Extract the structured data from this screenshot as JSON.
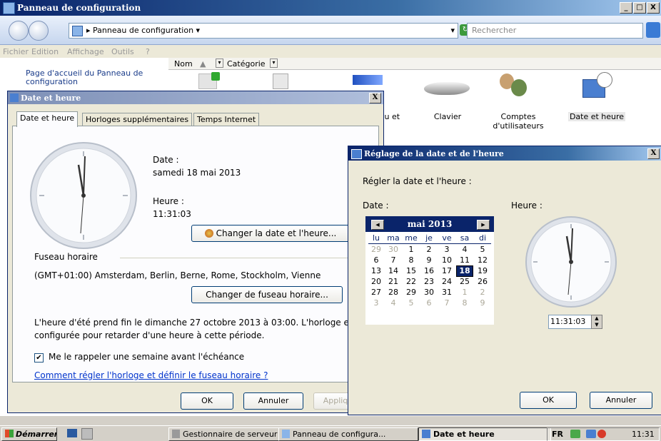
{
  "control_panel": {
    "title": "Panneau de configuration",
    "window_buttons": [
      "_",
      "□",
      "X"
    ],
    "address": "Panneau de configuration",
    "search_placeholder": "Rechercher",
    "menu": [
      "Fichier",
      "Edition",
      "Affichage",
      "Outils",
      "?"
    ],
    "columns": {
      "name": "Nom",
      "category": "Catégorie"
    },
    "sidebar_link": "Page d'accueil du Panneau de configuration",
    "items": [
      {
        "label": "...u et",
        "icon": "network-icon"
      },
      {
        "label": "Clavier",
        "icon": "keyboard-icon"
      },
      {
        "label": "Comptes d'utilisateurs",
        "icon": "users-icon"
      },
      {
        "label": "Date et heure",
        "icon": "calendar-clock-icon"
      }
    ]
  },
  "dialog_date": {
    "title": "Date et heure",
    "close": "X",
    "tabs": [
      "Date et heure",
      "Horloges supplémentaires",
      "Temps Internet"
    ],
    "date_label": "Date :",
    "date_value": "samedi 18 mai 2013",
    "time_label": "Heure :",
    "time_value": "11:31:03",
    "change_date_button": "Changer la date et l'heure...",
    "timezone_section": "Fuseau horaire",
    "timezone_value": "(GMT+01:00) Amsterdam, Berlin, Berne, Rome, Stockholm, Vienne",
    "change_tz_button": "Changer de fuseau horaire...",
    "dst_text_line1": "L'heure d'été prend fin le dimanche 27 octobre 2013 à 03:00. L'horloge es",
    "dst_text_line2": "configurée pour retarder d'une heure à cette période.",
    "reminder_checkbox": "Me le rappeler une semaine avant l'échéance",
    "reminder_checked": true,
    "help_link": "Comment régler l'horloge et définir le fuseau horaire ?",
    "ok": "OK",
    "cancel": "Annuler",
    "apply": "Appliq"
  },
  "dialog_set": {
    "title": "Réglage de la date et de l'heure",
    "close": "X",
    "instruction": "Régler la date et l'heure :",
    "date_label": "Date :",
    "time_label": "Heure :",
    "month": "mai 2013",
    "weekdays": [
      "lu",
      "ma",
      "me",
      "je",
      "ve",
      "sa",
      "di"
    ],
    "weeks": [
      [
        "29",
        "30",
        "1",
        "2",
        "3",
        "4",
        "5"
      ],
      [
        "6",
        "7",
        "8",
        "9",
        "10",
        "11",
        "12"
      ],
      [
        "13",
        "14",
        "15",
        "16",
        "17",
        "18",
        "19"
      ],
      [
        "20",
        "21",
        "22",
        "23",
        "24",
        "25",
        "26"
      ],
      [
        "27",
        "28",
        "29",
        "30",
        "31",
        "1",
        "2"
      ],
      [
        "3",
        "4",
        "5",
        "6",
        "7",
        "8",
        "9"
      ]
    ],
    "selected_day": "18",
    "time_value": "11:31:03",
    "ok": "OK",
    "cancel": "Annuler"
  },
  "taskbar": {
    "start": "Démarrer",
    "tasks": [
      "Gestionnaire de serveur",
      "Panneau de configura...",
      "Date et heure"
    ],
    "lang": "FR",
    "clock": "11:31"
  }
}
